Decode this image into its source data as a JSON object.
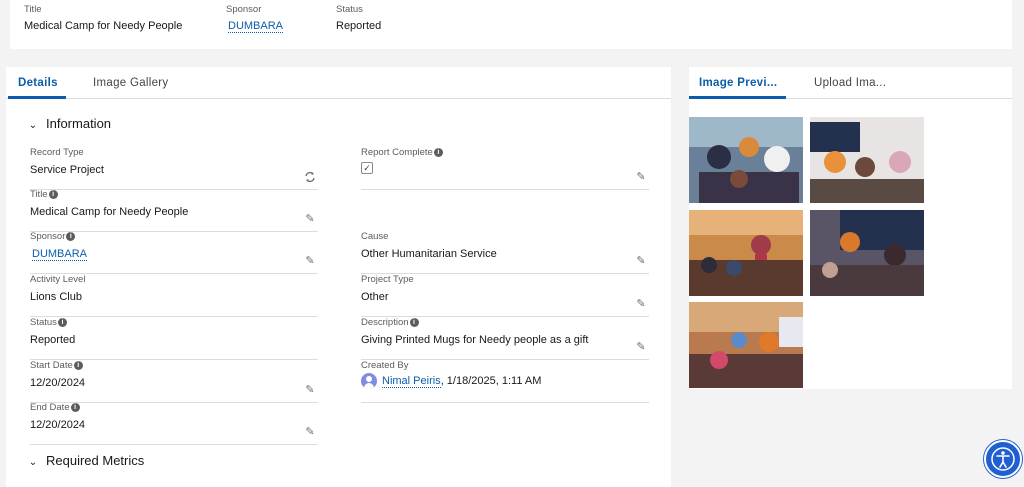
{
  "header": {
    "title_label": "Title",
    "title_value": "Medical Camp for Needy People",
    "sponsor_label": "Sponsor",
    "sponsor_value": "DUMBARA",
    "status_label": "Status",
    "status_value": "Reported"
  },
  "main": {
    "tabs": [
      {
        "label": "Details"
      },
      {
        "label": "Image Gallery"
      }
    ],
    "section_information": "Information",
    "section_required_metrics": "Required Metrics",
    "fields": {
      "record_type": {
        "label": "Record Type",
        "value": "Service Project"
      },
      "report_complete": {
        "label": "Report Complete",
        "value": "✓"
      },
      "title": {
        "label": "Title",
        "value": "Medical Camp for Needy People"
      },
      "sponsor": {
        "label": "Sponsor",
        "value": "DUMBARA"
      },
      "cause": {
        "label": "Cause",
        "value": "Other Humanitarian Service"
      },
      "activity_level": {
        "label": "Activity Level",
        "value": "Lions Club"
      },
      "project_type": {
        "label": "Project Type",
        "value": "Other"
      },
      "status": {
        "label": "Status",
        "value": "Reported"
      },
      "description": {
        "label": "Description",
        "value": "Giving Printed Mugs for Needy people as a gift"
      },
      "start_date": {
        "label": "Start Date",
        "value": "12/20/2024"
      },
      "created_by": {
        "label": "Created By",
        "user": "Nimal Peiris",
        "date": ", 1/18/2025, 1:11 AM"
      },
      "end_date": {
        "label": "End Date",
        "value": "12/20/2024"
      }
    }
  },
  "side": {
    "tabs": [
      {
        "label": "Image Previ..."
      },
      {
        "label": "Upload Ima..."
      }
    ],
    "images": [
      {
        "name": "photo-1",
        "tint": "#5d6f86"
      },
      {
        "name": "photo-2",
        "tint": "#6d7a8d"
      },
      {
        "name": "photo-3",
        "tint": "#9a6a3a"
      },
      {
        "name": "photo-4",
        "tint": "#5f5a68"
      },
      {
        "name": "photo-5",
        "tint": "#8a6a4e"
      }
    ]
  },
  "colors": {
    "accent": "#0b5cab",
    "accessibility_button": "#1f5fd1"
  }
}
